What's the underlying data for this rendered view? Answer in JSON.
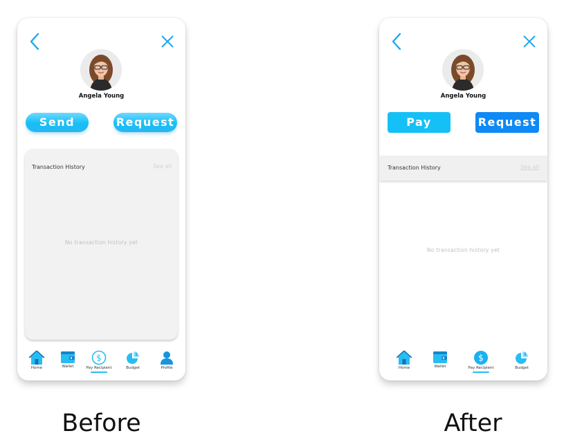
{
  "before": {
    "user_name": "Angela Young",
    "primary_button": "Send",
    "secondary_button": "Request",
    "history_title": "Transaction History",
    "see_all": "See all",
    "empty_text": "No transaction history yet",
    "nav": [
      "Home",
      "Wallet",
      "Pay Recipient",
      "Budget",
      "Profile"
    ],
    "caption": "Before"
  },
  "after": {
    "user_name": "Angela Young",
    "primary_button": "Pay",
    "secondary_button": "Request",
    "history_title": "Transaction History",
    "see_all": "See all",
    "empty_text": "No transaction history yet",
    "nav": [
      "Home",
      "Wallet",
      "Pay Recipient",
      "Budget"
    ],
    "caption": "After"
  },
  "colors": {
    "accent_blue": "#15c0f6",
    "request_blue": "#0f89f5",
    "icon_blue": "#27bdf3"
  },
  "icons": [
    "back-arrow-icon",
    "close-icon",
    "home-icon",
    "wallet-icon",
    "dollar-icon",
    "pie-chart-icon",
    "profile-icon"
  ]
}
